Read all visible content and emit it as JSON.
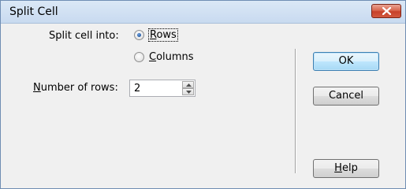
{
  "window": {
    "title": "Split Cell"
  },
  "split": {
    "label": "Split cell into:",
    "options": [
      {
        "label_mnemonic": "R",
        "label_rest": "ows",
        "checked": true
      },
      {
        "label_mnemonic": "C",
        "label_rest": "olumns",
        "checked": false
      }
    ]
  },
  "rows": {
    "label_mnemonic": "N",
    "label_rest": "umber of rows:",
    "value": "2"
  },
  "buttons": {
    "ok": "OK",
    "cancel": "Cancel",
    "help_mnemonic": "H",
    "help_rest": "elp"
  },
  "colors": {
    "titlebar": "#c8daf0",
    "close_button": "#c7412a",
    "default_button": "#bee6fd",
    "dialog_bg": "#f0f0f0"
  }
}
